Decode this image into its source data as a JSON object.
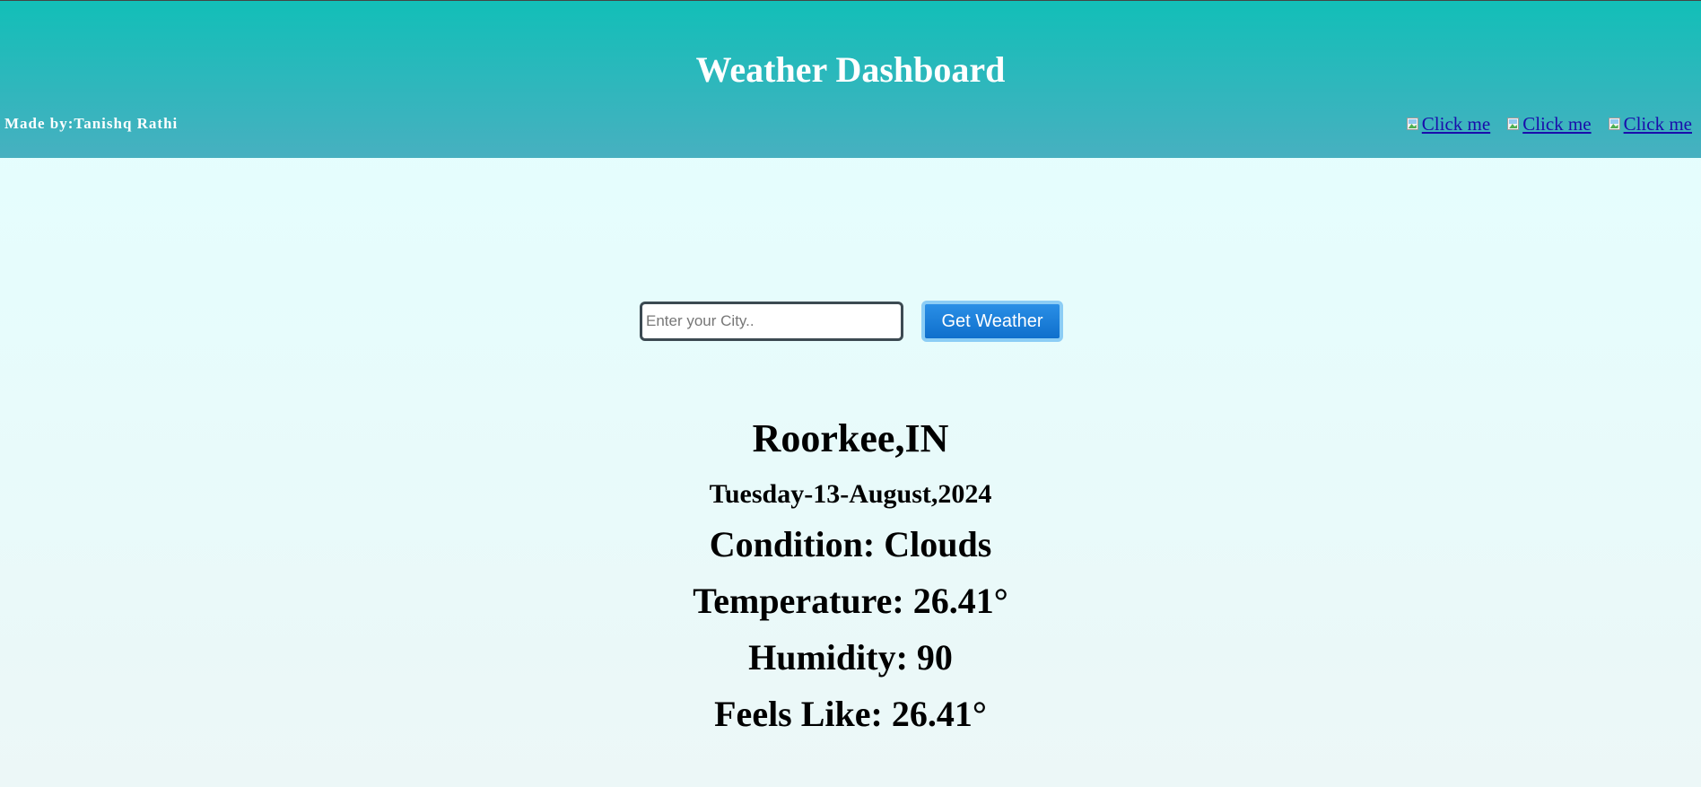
{
  "header": {
    "title": "Weather Dashboard",
    "credit": "Made by:Tanishq Rathi",
    "social_links": [
      {
        "label": "Click me",
        "icon": "broken-image-icon"
      },
      {
        "label": "Click me",
        "icon": "broken-image-icon"
      },
      {
        "label": "Click me",
        "icon": "broken-image-icon"
      }
    ]
  },
  "search": {
    "placeholder": "Enter your City..",
    "value": "",
    "button_label": "Get Weather"
  },
  "weather": {
    "city": "Roorkee,IN",
    "date": "Tuesday-13-August,2024",
    "condition": "Condition: Clouds",
    "temperature": "Temperature: 26.41°",
    "humidity": "Humidity: 90",
    "feels_like": "Feels Like: 26.41°"
  },
  "colors": {
    "header_top": "#12bfb8",
    "header_bottom": "#47b0c0",
    "page_background": "#e3ffff",
    "button_blue": "#1a7fdc",
    "link_color": "#1a0dab"
  }
}
